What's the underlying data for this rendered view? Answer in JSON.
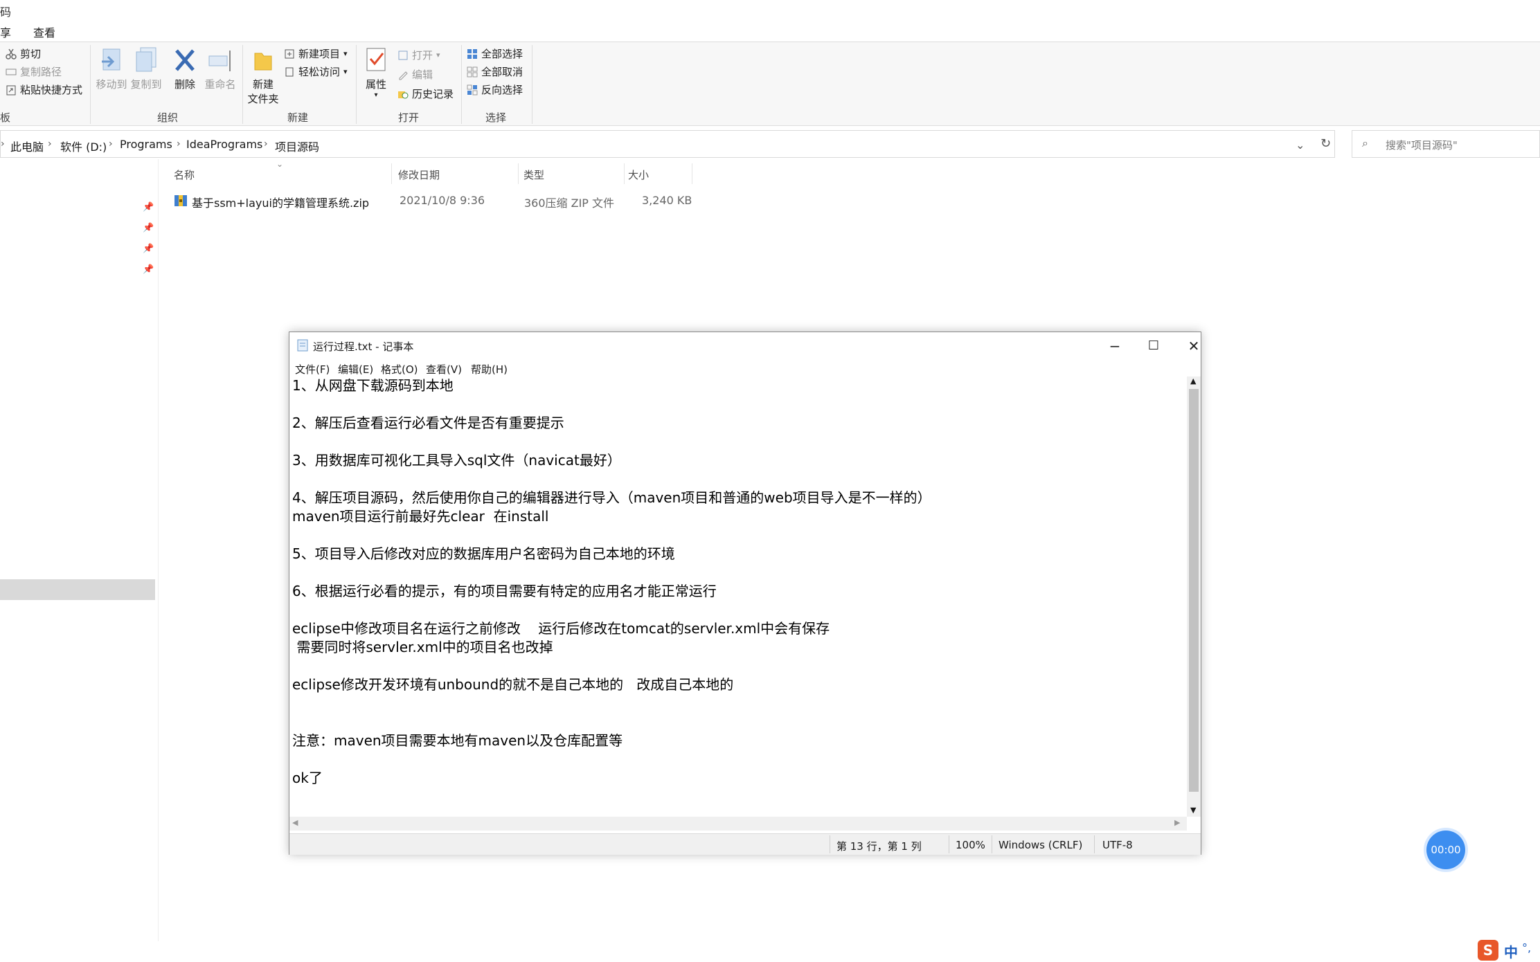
{
  "explorer": {
    "title_fragment": "码",
    "tabs": [
      "享",
      "查看"
    ],
    "ribbon": {
      "clipboard": {
        "cut": "剪切",
        "copy_path": "复制路径",
        "paste_shortcut": "粘贴快捷方式"
      },
      "organize": {
        "move_to": "移动到",
        "copy_to": "复制到",
        "delete": "删除",
        "rename": "重命名",
        "label": "组织"
      },
      "new": {
        "new_folder_line1": "新建",
        "new_folder_line2": "文件夹",
        "new_item": "新建项目",
        "easy_access": "轻松访问",
        "label": "新建"
      },
      "open": {
        "properties": "属性",
        "open": "打开",
        "edit": "编辑",
        "history": "历史记录",
        "label": "打开"
      },
      "select": {
        "select_all": "全部选择",
        "select_none": "全部取消",
        "invert": "反向选择",
        "label": "选择"
      },
      "left_edge_label": "板"
    },
    "breadcrumb": [
      "此电脑",
      "软件 (D:)",
      "Programs",
      "IdeaPrograms",
      "项目源码"
    ],
    "search_placeholder": "搜索\"项目源码\"",
    "columns": {
      "name": "名称",
      "date": "修改日期",
      "type": "类型",
      "size": "大小"
    },
    "file": {
      "name": "基于ssm+layui的学籍管理系统.zip",
      "date": "2021/10/8 9:36",
      "type": "360压缩 ZIP 文件",
      "size": "3,240 KB"
    }
  },
  "notepad": {
    "title": "运行过程.txt - 记事本",
    "menu": [
      "文件(F)",
      "编辑(E)",
      "格式(O)",
      "查看(V)",
      "帮助(H)"
    ],
    "content": "1、从网盘下载源码到本地\n\n2、解压后查看运行必看文件是否有重要提示\n\n3、用数据库可视化工具导入sql文件（navicat最好）\n\n4、解压项目源码，然后使用你自己的编辑器进行导入（maven项目和普通的web项目导入是不一样的）\nmaven项目运行前最好先clear  在install\n\n5、项目导入后修改对应的数据库用户名密码为自己本地的环境\n\n6、根据运行必看的提示，有的项目需要有特定的应用名才能正常运行\n\neclipse中修改项目名在运行之前修改    运行后修改在tomcat的servler.xml中会有保存\n 需要同时将servler.xml中的项目名也改掉\n\neclipse修改开发环境有unbound的就不是自己本地的   改成自己本地的\n\n\n注意：maven项目需要本地有maven以及仓库配置等\n\nok了",
    "status": {
      "position": "第 13 行，第 1 列",
      "zoom": "100%",
      "line_ending": "Windows (CRLF)",
      "encoding": "UTF-8"
    }
  },
  "timer": "00:00",
  "ime": {
    "logo": "S",
    "mode": "中",
    "punct": "°,"
  }
}
